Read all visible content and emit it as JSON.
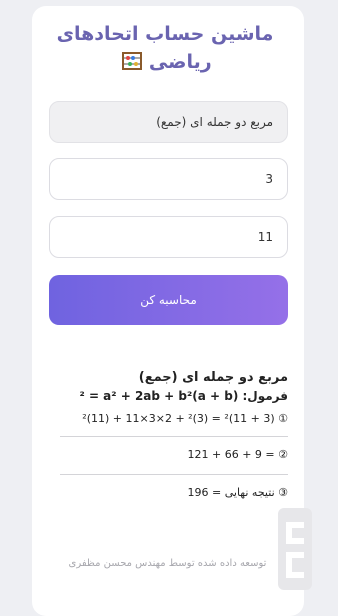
{
  "app": {
    "title": "ماشین حساب اتحادهای ریاضی",
    "title_icon": "abacus-icon"
  },
  "form": {
    "identity_select": {
      "value": "مربع دو جمله ای (جمع)"
    },
    "input_a": {
      "value": "3"
    },
    "input_b": {
      "value": "11"
    },
    "submit_label": "محاسبه کن"
  },
  "result": {
    "title": "مربع دو جمله ای (جمع)",
    "formula_label": "فرمول: (a + b)² = a² + 2ab + b²",
    "steps": [
      "① (3 + 11)² = (3)² + 2×3×11 + (11)²",
      "② = 9 + 66 + 121",
      "③ نتیجه نهایی = 196"
    ]
  },
  "footer": {
    "text": "توسعه داده شده توسط مهندس محسن مظفری"
  },
  "colors": {
    "accent_start": "#6f63e0",
    "accent_end": "#9570e8",
    "title_color": "#6a64b0",
    "background": "#eeeff3"
  }
}
